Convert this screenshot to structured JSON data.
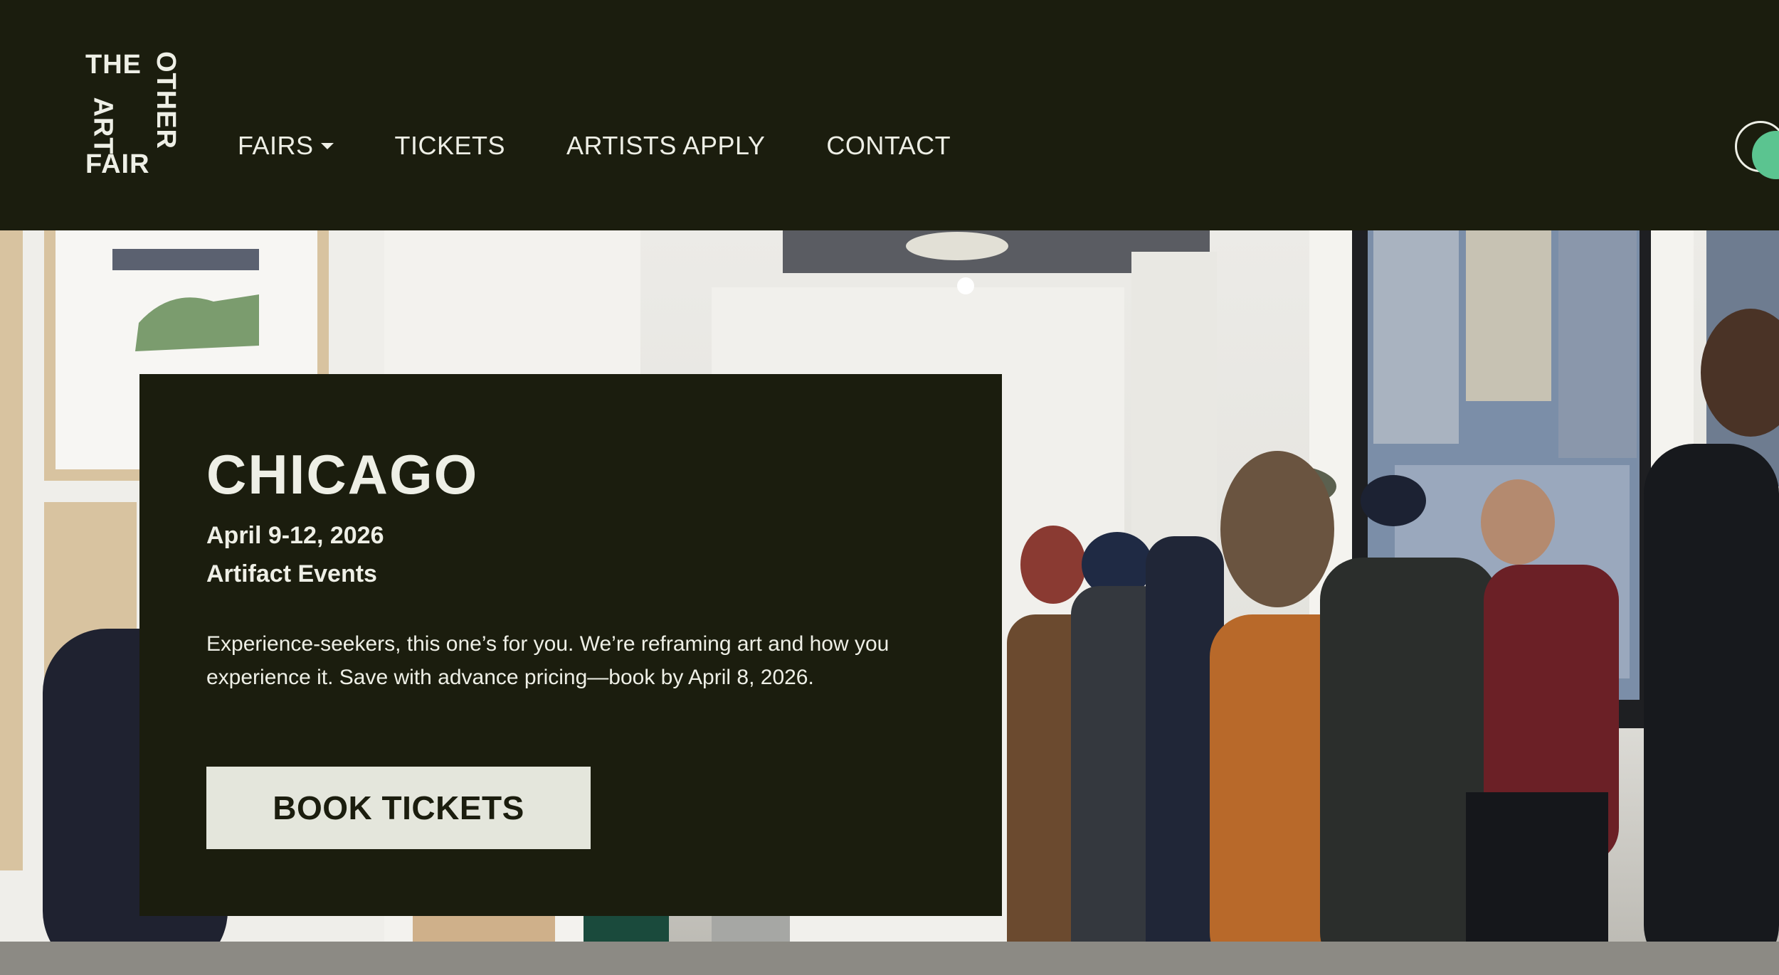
{
  "logo": {
    "the": "THE",
    "other": "OTHER",
    "art": "ART",
    "fair": "FAIR"
  },
  "nav": {
    "fairs": "FAIRS",
    "tickets": "TICKETS",
    "artists_apply": "ARTISTS APPLY",
    "contact": "CONTACT"
  },
  "icons": {
    "fairs_dropdown": "caret-down-icon",
    "theme_toggle": "toggle-icon"
  },
  "colors": {
    "background": "#1b1d0e",
    "text": "#eeefe6",
    "cta_bg": "#e4e6dc",
    "accent": "#5bc490"
  },
  "event": {
    "city": "CHICAGO",
    "dates": "April 9-12, 2026",
    "organizer": "Artifact Events",
    "description": "Experience-seekers, this one’s for you. We’re reframing art and how you experience it. Save with advance pricing—book by April 8, 2026.",
    "cta_label": "BOOK TICKETS"
  }
}
